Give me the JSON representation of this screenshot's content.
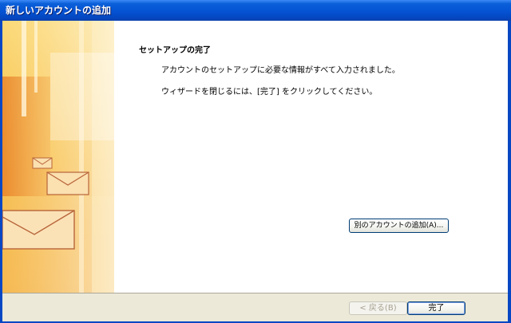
{
  "window": {
    "title": "新しいアカウントの追加"
  },
  "content": {
    "heading": "セットアップの完了",
    "line1": "アカウントのセットアップに必要な情報がすべて入力されました。",
    "line2": "ウィザードを閉じるには、[完了] をクリックしてください。",
    "add_account_label": "別のアカウントの追加(A)..."
  },
  "footer": {
    "back_label": "< 戻る(B)",
    "finish_label": "完了"
  },
  "colors": {
    "title_bar": "#0553d4",
    "frame": "#0747c4",
    "dialog_background": "#ece9d8",
    "art_orange": "#f0a030"
  },
  "icons": [
    "envelope-icon"
  ]
}
